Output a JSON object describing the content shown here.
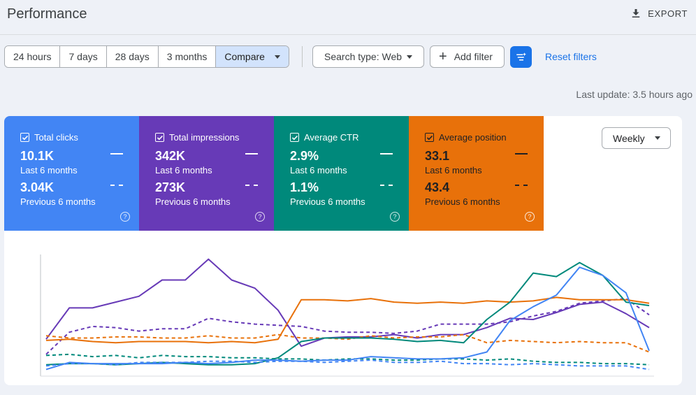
{
  "header": {
    "title": "Performance",
    "export_label": "EXPORT"
  },
  "toolbar": {
    "ranges": [
      "24 hours",
      "7 days",
      "28 days",
      "3 months"
    ],
    "compare_label": "Compare",
    "search_type": "Search type: Web",
    "add_filter": "Add filter",
    "reset_filters": "Reset filters",
    "last_update": "Last update: 3.5 hours ago"
  },
  "metrics": [
    {
      "title": "Total clicks",
      "value1": "10.1K",
      "label1": "Last 6 months",
      "value2": "3.04K",
      "label2": "Previous 6 months",
      "color": "#4285f4"
    },
    {
      "title": "Total impressions",
      "value1": "342K",
      "label1": "Last 6 months",
      "value2": "273K",
      "label2": "Previous 6 months",
      "color": "#673ab7"
    },
    {
      "title": "Average CTR",
      "value1": "2.9%",
      "label1": "Last 6 months",
      "value2": "1.1%",
      "label2": "Previous 6 months",
      "color": "#00897b"
    },
    {
      "title": "Average position",
      "value1": "33.1",
      "label1": "Last 6 months",
      "value2": "43.4",
      "label2": "Previous 6 months",
      "color": "#e8710a"
    }
  ],
  "granularity": "Weekly",
  "icons": {
    "export": "download-icon",
    "filter": "filter-sort-icon",
    "help": "help-circle-icon",
    "checkbox": "checkbox-checked-icon"
  },
  "chart_data": {
    "type": "line",
    "x": [
      1,
      2,
      3,
      4,
      5,
      6,
      7,
      8,
      9,
      10,
      11,
      12,
      13,
      14,
      15,
      16,
      17,
      18,
      19,
      20,
      21,
      22,
      23,
      24,
      25,
      26,
      27
    ],
    "ylim": [
      0,
      100
    ],
    "grid": false,
    "legend": "none",
    "series": [
      {
        "color": "#673ab7",
        "dashed": false,
        "values": [
          30,
          57,
          57,
          62,
          67,
          81,
          81,
          99,
          81,
          74,
          55,
          24,
          31,
          32,
          32,
          34,
          31,
          34,
          34,
          40,
          48,
          47,
          53,
          60,
          62,
          52,
          40
        ]
      },
      {
        "color": "#673ab7",
        "dashed": true,
        "values": [
          17,
          36,
          41,
          40,
          37,
          39,
          39,
          48,
          45,
          43,
          42,
          41,
          37,
          36,
          36,
          35,
          37,
          43,
          43,
          43,
          45,
          50,
          54,
          61,
          63,
          65,
          51
        ]
      },
      {
        "color": "#e8710a",
        "dashed": false,
        "values": [
          29,
          30,
          28,
          27,
          28,
          28,
          28,
          27,
          28,
          27,
          30,
          64,
          64,
          63,
          65,
          62,
          61,
          62,
          61,
          63,
          62,
          63,
          66,
          64,
          64,
          64,
          61
        ]
      },
      {
        "color": "#e8710a",
        "dashed": true,
        "values": [
          33,
          31,
          31,
          32,
          32,
          31,
          31,
          33,
          31,
          31,
          34,
          31,
          31,
          30,
          33,
          31,
          32,
          32,
          34,
          27,
          29,
          28,
          27,
          28,
          27,
          27,
          19
        ]
      },
      {
        "color": "#00897b",
        "dashed": false,
        "values": [
          8,
          9,
          9,
          8,
          9,
          10,
          9,
          8,
          8,
          9,
          14,
          28,
          31,
          31,
          31,
          30,
          28,
          29,
          27,
          47,
          62,
          87,
          84,
          96,
          85,
          62,
          59
        ]
      },
      {
        "color": "#00897b",
        "dashed": true,
        "values": [
          16,
          17,
          15,
          16,
          14,
          16,
          15,
          15,
          14,
          14,
          13,
          13,
          12,
          13,
          13,
          12,
          12,
          13,
          13,
          12,
          13,
          11,
          10,
          10,
          9,
          9,
          8
        ]
      },
      {
        "color": "#4285f4",
        "dashed": false,
        "values": [
          4,
          10,
          9,
          9,
          9,
          9,
          10,
          9,
          10,
          12,
          12,
          11,
          12,
          12,
          15,
          14,
          13,
          13,
          14,
          19,
          46,
          58,
          68,
          92,
          85,
          70,
          20
        ]
      },
      {
        "color": "#4285f4",
        "dashed": true,
        "values": [
          7,
          9,
          9,
          8,
          10,
          10,
          10,
          11,
          11,
          10,
          11,
          11,
          10,
          11,
          12,
          10,
          10,
          11,
          9,
          9,
          8,
          9,
          8,
          7,
          7,
          7,
          4
        ]
      }
    ]
  }
}
